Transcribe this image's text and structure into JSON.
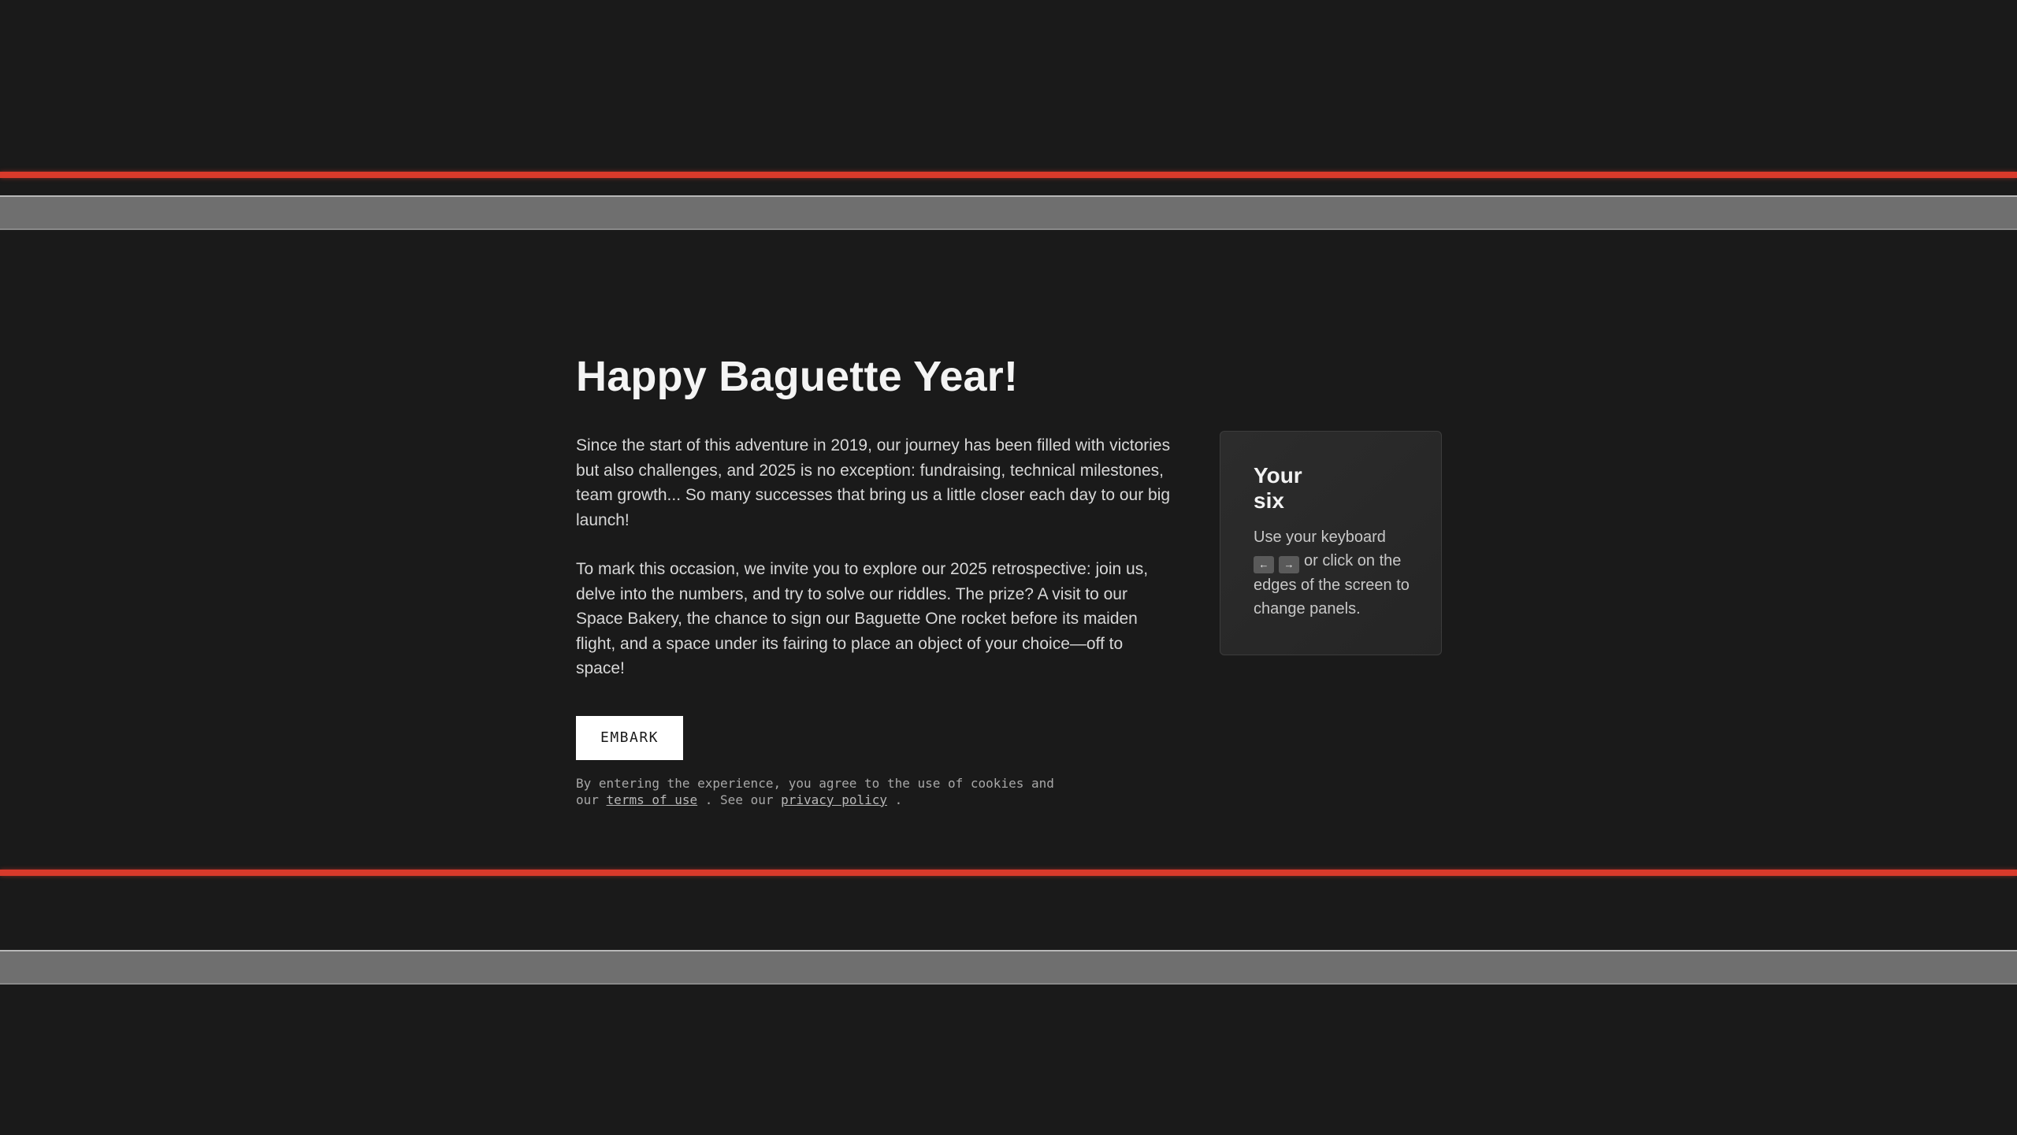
{
  "intro": {
    "title": "Happy Baguette Year!",
    "paragraph_1": "Since the start of this adventure in 2019, our journey has been filled with victories but also challenges, and 2025 is no exception: fundraising, technical milestones, team growth... So many successes that bring us a little closer each day to our big launch!",
    "paragraph_2": "To mark this occasion, we invite you to explore our 2025 retrospective: join us, delve into the numbers, and try to solve our riddles. The prize? A visit to our Space Bakery, the chance to sign our Baguette One rocket before its maiden flight, and a space under its fairing to place an object of your choice—off to space!",
    "embark_label": "EMBARK",
    "legal": {
      "prefix": "By entering the experience, you agree to the use of cookies and our",
      "terms_link": "terms of use",
      "middle": ". See our",
      "privacy_link": "privacy policy",
      "suffix": "."
    }
  },
  "help_card": {
    "title": "Your six",
    "text_before_keys": "Use your keyboard",
    "key_left": "←",
    "key_right": "→",
    "text_after_keys": "or click on the edges of the screen to change panels."
  },
  "colors": {
    "background": "#1a1a1a",
    "stripe_red": "#d93a2b",
    "stripe_grey": "#6f6f6f",
    "button_bg": "#ffffff"
  }
}
